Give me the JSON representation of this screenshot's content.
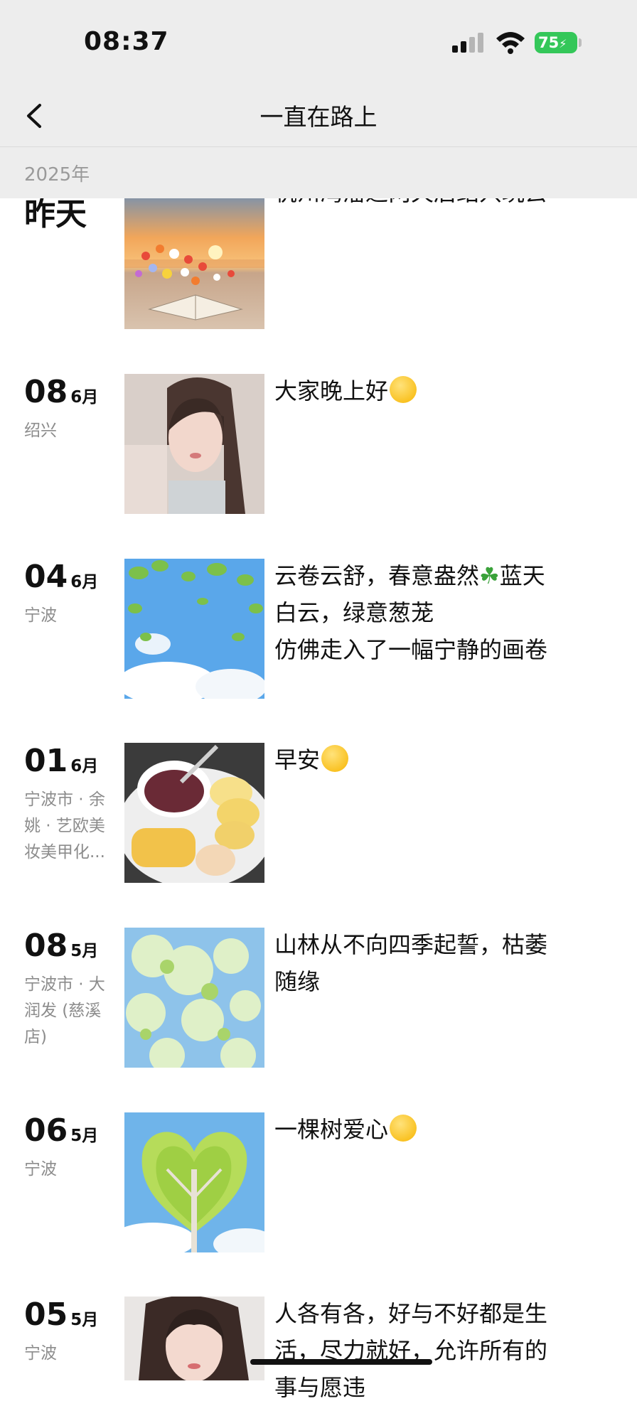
{
  "status_bar": {
    "time": "08:37",
    "battery": "75"
  },
  "nav": {
    "title": "一直在路上"
  },
  "year_header": "2025年",
  "entries": [
    {
      "label": "昨天",
      "text": "杭州湾潘达两天后绍兴玩去"
    },
    {
      "day": "08",
      "month": "6月",
      "location": "绍兴",
      "text": "大家晚上好"
    },
    {
      "day": "04",
      "month": "6月",
      "location": "宁波",
      "text_line1": "云卷云舒，春意盎然",
      "text_line1b": "蓝天",
      "text_line2": "白云，绿意葱茏",
      "text_line3": "仿佛走入了一幅宁静的画卷"
    },
    {
      "day": "01",
      "month": "6月",
      "location_line1": "宁波市 · 余",
      "location_line2": "姚 · 艺欧美",
      "location_line3": "妆美甲化...",
      "text": "早安"
    },
    {
      "day": "08",
      "month": "5月",
      "location_line1": "宁波市 · 大",
      "location_line2": "润发 (慈溪",
      "location_line3": "店)",
      "text_line1": "山林从不向四季起誓，枯萎",
      "text_line2": "随缘"
    },
    {
      "day": "06",
      "month": "5月",
      "location": "宁波",
      "text": "一棵树爱心"
    },
    {
      "day": "05",
      "month": "5月",
      "location": "宁波",
      "text_line1": "人各有各，好与不好都是生",
      "text_line2": "活，尽力就好，允许所有的",
      "text_line3": "事与愿违"
    }
  ],
  "icons": {
    "back": "chevron-left-icon",
    "signal": "cellular-signal-icon",
    "wifi": "wifi-icon",
    "battery": "battery-charging-icon",
    "clover": "four-leaf-clover-emoji",
    "smile": "smiling-face-emoji"
  },
  "colors": {
    "battery_green": "#34c759",
    "header_bg": "#ededed",
    "secondary_text": "#8c8c8c"
  }
}
